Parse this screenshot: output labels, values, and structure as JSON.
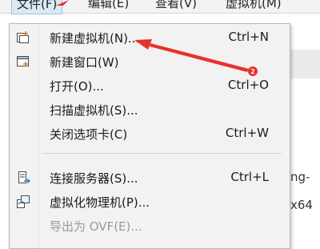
{
  "menubar": {
    "items": [
      {
        "label": "文件(F)",
        "active": true
      },
      {
        "label": "编辑(E)"
      },
      {
        "label": "查看(V)"
      },
      {
        "label": "虚拟机(M)"
      }
    ]
  },
  "menu": {
    "items": [
      {
        "label": "新建虚拟机(N)...",
        "shortcut": "Ctrl+N",
        "icon": "new-vm-icon"
      },
      {
        "label": "新建窗口(W)",
        "shortcut": "",
        "icon": "new-window-icon"
      },
      {
        "label": "打开(O)...",
        "shortcut": "Ctrl+O",
        "icon": ""
      },
      {
        "label": "扫描虚拟机(S)...",
        "shortcut": "",
        "icon": ""
      },
      {
        "label": "关闭选项卡(C)",
        "shortcut": "Ctrl+W",
        "icon": ""
      },
      {
        "label": "连接服务器(S)...",
        "shortcut": "Ctrl+L",
        "icon": "connect-server-icon"
      },
      {
        "label": "虚拟化物理机(P)...",
        "shortcut": "",
        "icon": "virtualize-physical-icon"
      },
      {
        "label": "导出为 OVF(E)...",
        "shortcut": "",
        "icon": "",
        "disabled": true
      }
    ]
  },
  "background": {
    "text1": "ng-",
    "text2": "x64"
  },
  "annotation": {
    "badge": "2",
    "color": "#e8302a"
  }
}
